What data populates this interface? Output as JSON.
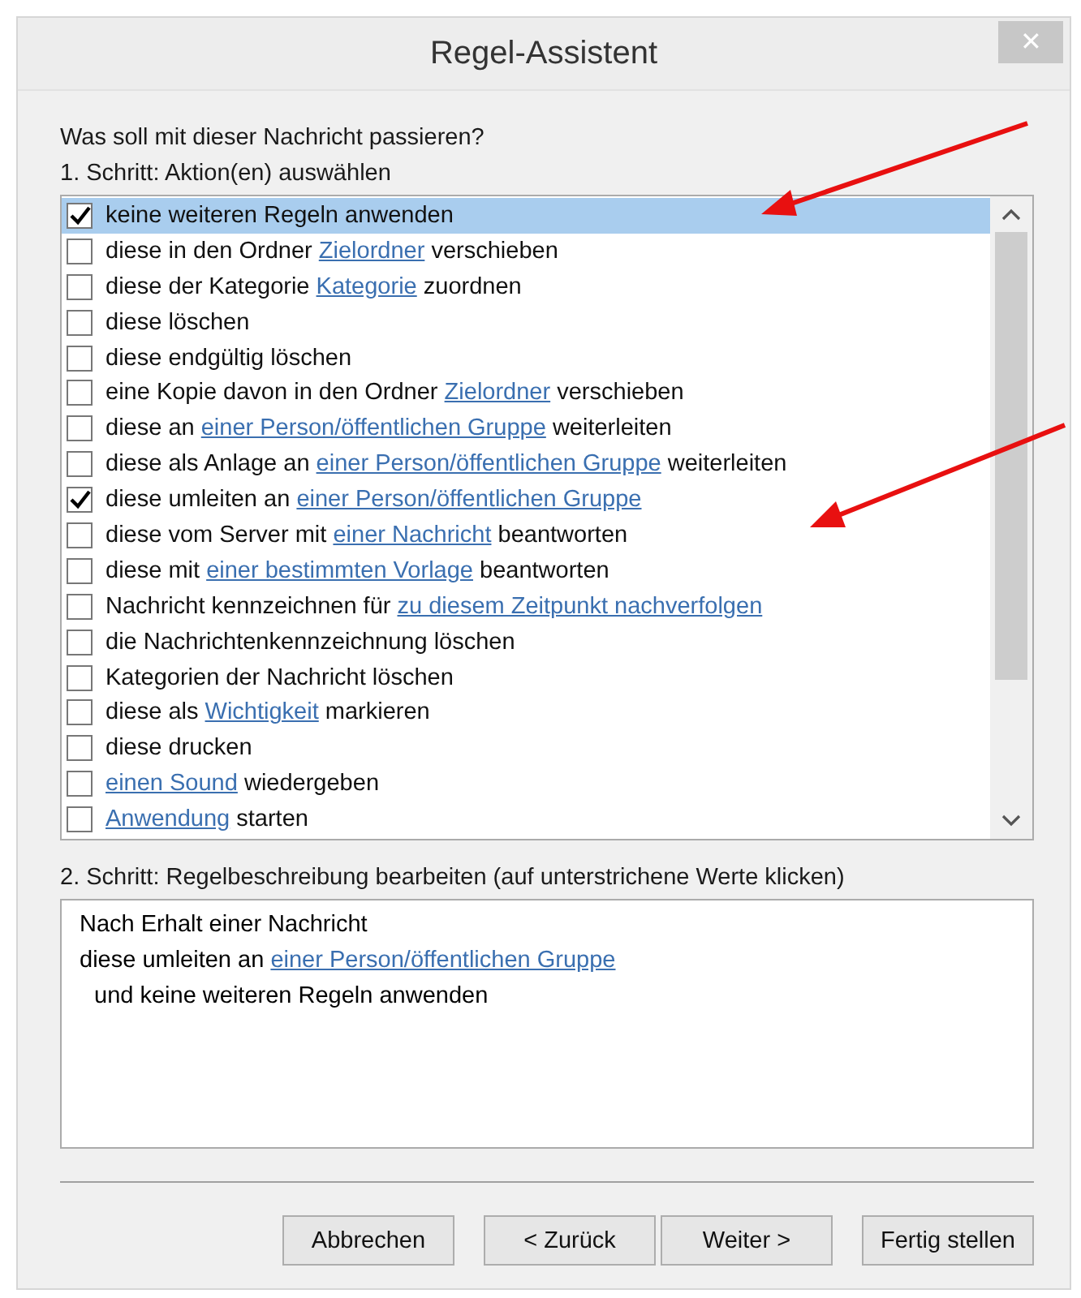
{
  "window": {
    "title": "Regel-Assistent",
    "close": "✕"
  },
  "question": "Was soll mit dieser Nachricht passieren?",
  "step1": {
    "label": "1. Schritt: Aktion(en) auswählen",
    "actions": [
      {
        "checked": true,
        "selected": true,
        "parts": [
          {
            "text": "keine weiteren Regeln anwenden",
            "link": false
          }
        ]
      },
      {
        "checked": false,
        "selected": false,
        "parts": [
          {
            "text": "diese in den Ordner",
            "link": false
          },
          {
            "text": "Zielordner",
            "link": true
          },
          {
            "text": "verschieben",
            "link": false
          }
        ]
      },
      {
        "checked": false,
        "selected": false,
        "parts": [
          {
            "text": "diese der Kategorie",
            "link": false
          },
          {
            "text": "Kategorie",
            "link": true
          },
          {
            "text": "zuordnen",
            "link": false
          }
        ]
      },
      {
        "checked": false,
        "selected": false,
        "parts": [
          {
            "text": "diese löschen",
            "link": false
          }
        ]
      },
      {
        "checked": false,
        "selected": false,
        "parts": [
          {
            "text": "diese endgültig löschen",
            "link": false
          }
        ]
      },
      {
        "checked": false,
        "selected": false,
        "parts": [
          {
            "text": "eine Kopie davon in den Ordner",
            "link": false
          },
          {
            "text": "Zielordner",
            "link": true
          },
          {
            "text": "verschieben",
            "link": false
          }
        ]
      },
      {
        "checked": false,
        "selected": false,
        "parts": [
          {
            "text": "diese an",
            "link": false
          },
          {
            "text": "einer Person/öffentlichen Gruppe",
            "link": true
          },
          {
            "text": "weiterleiten",
            "link": false
          }
        ]
      },
      {
        "checked": false,
        "selected": false,
        "parts": [
          {
            "text": "diese als Anlage an",
            "link": false
          },
          {
            "text": "einer Person/öffentlichen Gruppe",
            "link": true
          },
          {
            "text": "weiterleiten",
            "link": false
          }
        ]
      },
      {
        "checked": true,
        "selected": false,
        "parts": [
          {
            "text": "diese umleiten an",
            "link": false
          },
          {
            "text": "einer Person/öffentlichen Gruppe",
            "link": true
          }
        ]
      },
      {
        "checked": false,
        "selected": false,
        "parts": [
          {
            "text": "diese vom Server mit",
            "link": false
          },
          {
            "text": "einer Nachricht",
            "link": true
          },
          {
            "text": "beantworten",
            "link": false
          }
        ]
      },
      {
        "checked": false,
        "selected": false,
        "parts": [
          {
            "text": "diese mit",
            "link": false
          },
          {
            "text": "einer bestimmten Vorlage",
            "link": true
          },
          {
            "text": "beantworten",
            "link": false
          }
        ]
      },
      {
        "checked": false,
        "selected": false,
        "parts": [
          {
            "text": "Nachricht kennzeichnen für",
            "link": false
          },
          {
            "text": "zu diesem Zeitpunkt nachverfolgen",
            "link": true
          }
        ]
      },
      {
        "checked": false,
        "selected": false,
        "parts": [
          {
            "text": "die Nachrichtenkennzeichnung löschen",
            "link": false
          }
        ]
      },
      {
        "checked": false,
        "selected": false,
        "parts": [
          {
            "text": "Kategorien der Nachricht löschen",
            "link": false
          }
        ]
      },
      {
        "checked": false,
        "selected": false,
        "parts": [
          {
            "text": "diese als",
            "link": false
          },
          {
            "text": "Wichtigkeit",
            "link": true
          },
          {
            "text": "markieren",
            "link": false
          }
        ]
      },
      {
        "checked": false,
        "selected": false,
        "parts": [
          {
            "text": "diese drucken",
            "link": false
          }
        ]
      },
      {
        "checked": false,
        "selected": false,
        "parts": [
          {
            "text": "einen Sound",
            "link": true
          },
          {
            "text": "wiedergeben",
            "link": false
          }
        ]
      },
      {
        "checked": false,
        "selected": false,
        "parts": [
          {
            "text": "Anwendung",
            "link": true
          },
          {
            "text": "starten",
            "link": false
          }
        ]
      }
    ]
  },
  "step2": {
    "label": "2. Schritt: Regelbeschreibung bearbeiten (auf unterstrichene Werte klicken)",
    "lines": [
      {
        "indented": false,
        "parts": [
          {
            "text": "Nach Erhalt einer Nachricht",
            "link": false
          }
        ]
      },
      {
        "indented": false,
        "parts": [
          {
            "text": "diese umleiten an",
            "link": false
          },
          {
            "text": "einer Person/öffentlichen Gruppe",
            "link": true
          }
        ]
      },
      {
        "indented": true,
        "parts": [
          {
            "text": "und keine weiteren Regeln anwenden",
            "link": false
          }
        ]
      }
    ]
  },
  "buttons": [
    "Abbrechen",
    "< Zurück",
    "Weiter >",
    "Fertig stellen"
  ]
}
